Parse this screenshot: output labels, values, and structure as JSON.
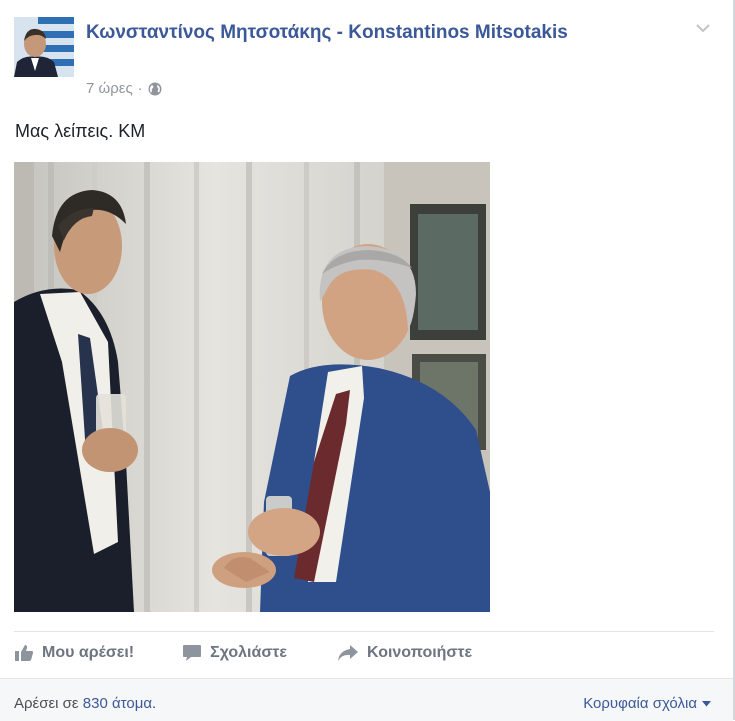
{
  "post": {
    "author": "Κωνσταντίνος Μητσοτάκης - Konstantinos Mitsotakis",
    "timestamp": "7 ώρες",
    "separator": "·",
    "audience_icon": "globe-icon",
    "message": "Μας λείπεις. ΚΜ",
    "photo_alt": "photo"
  },
  "actions": {
    "like": {
      "label": "Μου αρέσει!",
      "icon": "thumbs-up-icon"
    },
    "comment": {
      "label": "Σχολιάστε",
      "icon": "comment-icon"
    },
    "share": {
      "label": "Κοινοποιήστε",
      "icon": "share-arrow-icon"
    }
  },
  "footer": {
    "likes_prefix": "Αρέσει σε",
    "likes_count": "830 άτομα",
    "likes_suffix": ".",
    "top_comments": "Κορυφαία σχόλια"
  },
  "colors": {
    "link": "#3b5998",
    "muted": "#90949c",
    "action": "#6d7580",
    "footer_bg": "#f6f7f9"
  }
}
